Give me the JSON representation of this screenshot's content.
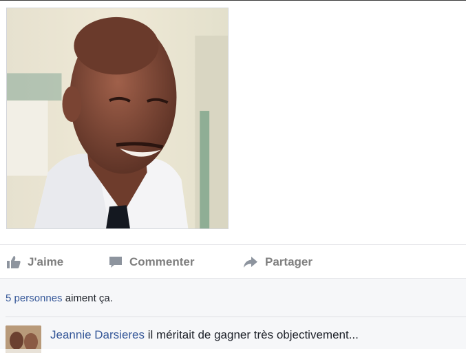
{
  "post": {
    "photo_alt": "Photo"
  },
  "actions": {
    "like_label": "J'aime",
    "comment_label": "Commenter",
    "share_label": "Partager"
  },
  "likes": {
    "count_link": "5 personnes",
    "suffix": " aiment ça."
  },
  "comment": {
    "author": "Jeannie Darsieres",
    "text": " il méritait de gagner très objectivement..."
  },
  "colors": {
    "link": "#365899",
    "action_gray": "#7f7f7f",
    "summary_bg": "#f6f7f9"
  }
}
